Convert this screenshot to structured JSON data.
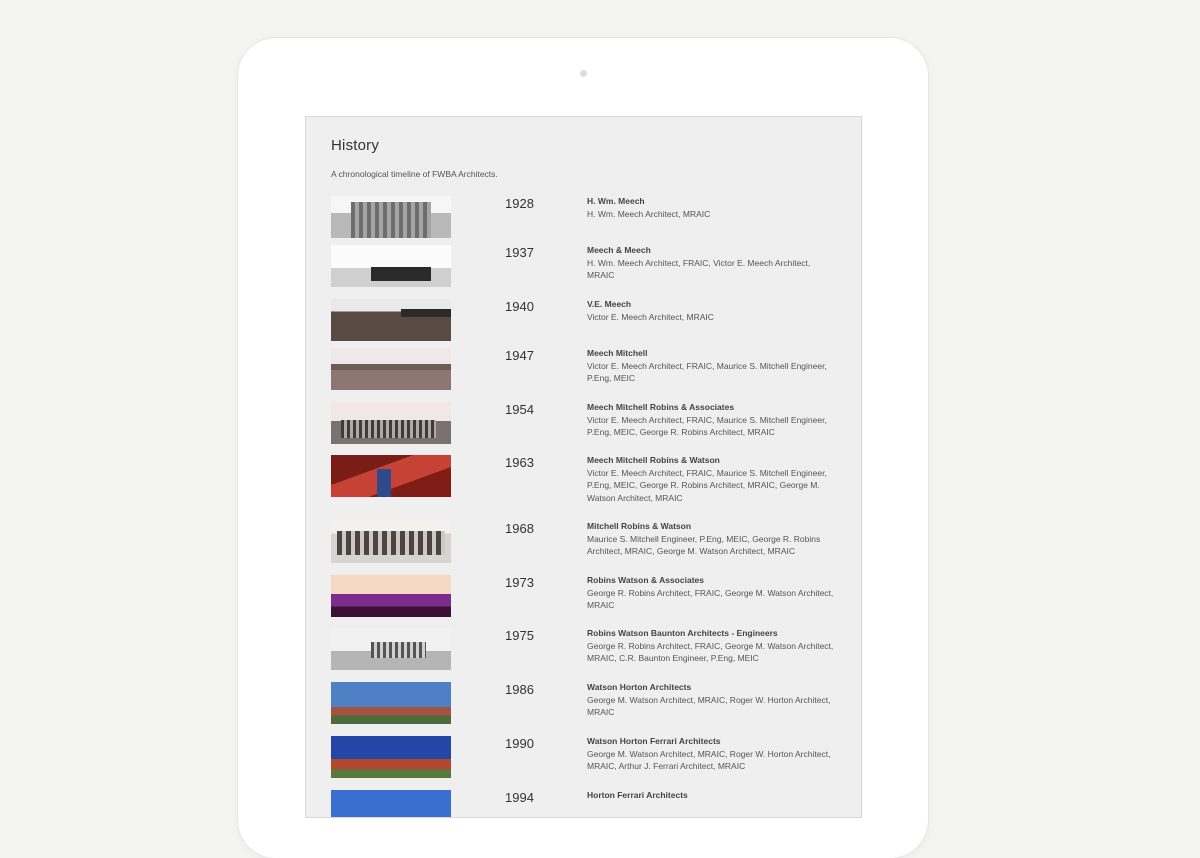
{
  "page": {
    "title": "History",
    "subtitle": "A chronological timeline of FWBA Architects."
  },
  "entries": [
    {
      "year": "1928",
      "name": "H. Wm. Meech",
      "desc": "H. Wm. Meech Architect, MRAIC",
      "thumb": "bw-old"
    },
    {
      "year": "1937",
      "name": "Meech & Meech",
      "desc": "H. Wm. Meech Architect, FRAIC, Victor E. Meech Architect, MRAIC",
      "thumb": "bw-low"
    },
    {
      "year": "1940",
      "name": "V.E. Meech",
      "desc": "Victor E. Meech Architect, MRAIC",
      "thumb": "bw-brick"
    },
    {
      "year": "1947",
      "name": "Meech Mitchell",
      "desc": "Victor E. Meech Architect, FRAIC, Maurice S. Mitchell Engineer, P.Eng, MEIC",
      "thumb": "sepia"
    },
    {
      "year": "1954",
      "name": "Meech Mitchell Robins & Associates",
      "desc": "Victor E. Meech Architect, FRAIC, Maurice S. Mitchell Engineer, P.Eng, MEIC, George R. Robins Architect, MRAIC",
      "thumb": "sepia2"
    },
    {
      "year": "1963",
      "name": "Meech Mitchell Robins & Watson",
      "desc": "Victor E. Meech Architect, FRAIC, Maurice S. Mitchell Engineer, P.Eng, MEIC, George R. Robins Architect, MRAIC, George M. Watson Architect, MRAIC",
      "thumb": "red"
    },
    {
      "year": "1968",
      "name": "Mitchell Robins & Watson",
      "desc": "Maurice S. Mitchell Engineer, P.Eng, MEIC, George R. Robins Architect, MRAIC, George M. Watson Architect, MRAIC",
      "thumb": "facade"
    },
    {
      "year": "1973",
      "name": "Robins Watson & Associates",
      "desc": "George R. Robins Architect, FRAIC, George M. Watson Architect, MRAIC",
      "thumb": "purple"
    },
    {
      "year": "1975",
      "name": "Robins Watson Baunton Architects - Engineers",
      "desc": "George R. Robins Architect, FRAIC, George M. Watson Architect, MRAIC, C.R. Baunton Engineer, P.Eng, MEIC",
      "thumb": "bw-trees"
    },
    {
      "year": "1986",
      "name": "Watson Horton Architects",
      "desc": "George M. Watson Architect, MRAIC, Roger W. Horton Architect, MRAIC",
      "thumb": "sky"
    },
    {
      "year": "1990",
      "name": "Watson Horton Ferrari Architects",
      "desc": "George M. Watson Architect, MRAIC, Roger W. Horton Architect, MRAIC, Arthur J. Ferrari Architect, MRAIC",
      "thumb": "sky2"
    },
    {
      "year": "1994",
      "name": "Horton Ferrari Architects",
      "desc": "",
      "thumb": "sky3"
    }
  ]
}
